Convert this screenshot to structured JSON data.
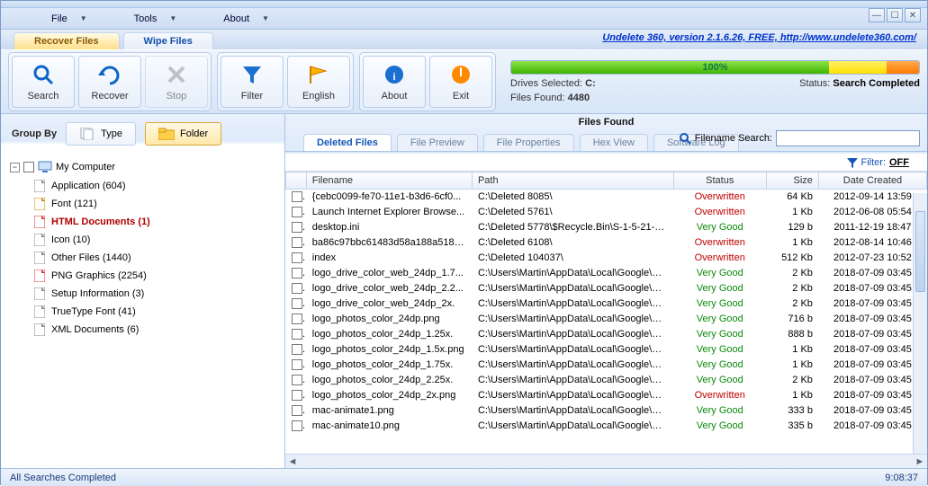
{
  "menu": {
    "file": "File",
    "tools": "Tools",
    "about": "About"
  },
  "tabs": {
    "recover": "Recover Files",
    "wipe": "Wipe Files"
  },
  "version_link": "Undelete 360, version 2.1.6.26, FREE, http://www.undelete360.com/",
  "toolbar": {
    "search": "Search",
    "recover": "Recover",
    "stop": "Stop",
    "filter": "Filter",
    "english": "English",
    "about": "About",
    "exit": "Exit"
  },
  "progress_pct": "100%",
  "drives_label": "Drives Selected: ",
  "drives_value": "C:",
  "found_label": "Files Found: ",
  "found_value": "4480",
  "status_label": "Status: ",
  "status_value": "Search Completed",
  "group_by": "Group By",
  "type_btn": "Type",
  "folder_btn": "Folder",
  "tree_root": "My Computer",
  "tree_items": [
    "Application (604)",
    "Font (121)",
    "HTML Documents (1)",
    "Icon (10)",
    "Other Files (1440)",
    "PNG Graphics (2254)",
    "Setup Information (3)",
    "TrueType Font (41)",
    "XML Documents (6)"
  ],
  "tree_selected_index": 2,
  "files_found_title": "Files Found",
  "right_tabs": {
    "deleted": "Deleted Files",
    "preview": "File Preview",
    "props": "File Properties",
    "hex": "Hex View",
    "log": "Software Log"
  },
  "search_label": "Filename Search:",
  "filter_label": "Filter:",
  "filter_state": "OFF",
  "columns": {
    "fn": "Filename",
    "path": "Path",
    "status": "Status",
    "size": "Size",
    "date": "Date Created"
  },
  "rows": [
    {
      "fn": "{cebc0099-fe70-11e1-b3d6-6cf0...",
      "path": "C:\\Deleted 8085\\",
      "status": "Overwritten",
      "size": "64 Kb",
      "date": "2012-09-14 13:59"
    },
    {
      "fn": "Launch Internet Explorer Browse...",
      "path": "C:\\Deleted 5761\\",
      "status": "Overwritten",
      "size": "1 Kb",
      "date": "2012-06-08 05:54"
    },
    {
      "fn": "desktop.ini",
      "path": "C:\\Deleted 5778\\$Recycle.Bin\\S-1-5-21-2...",
      "status": "Very Good",
      "size": "129 b",
      "date": "2011-12-19 18:47"
    },
    {
      "fn": "ba86c97bbc61483d58a188a5182...",
      "path": "C:\\Deleted 6108\\",
      "status": "Overwritten",
      "size": "1 Kb",
      "date": "2012-08-14 10:46"
    },
    {
      "fn": "index",
      "path": "C:\\Deleted 104037\\",
      "status": "Overwritten",
      "size": "512 Kb",
      "date": "2012-07-23 10:52"
    },
    {
      "fn": "logo_drive_color_web_24dp_1.7...",
      "path": "C:\\Users\\Martin\\AppData\\Local\\Google\\Ch...",
      "status": "Very Good",
      "size": "2 Kb",
      "date": "2018-07-09 03:45"
    },
    {
      "fn": "logo_drive_color_web_24dp_2.2...",
      "path": "C:\\Users\\Martin\\AppData\\Local\\Google\\Ch...",
      "status": "Very Good",
      "size": "2 Kb",
      "date": "2018-07-09 03:45"
    },
    {
      "fn": "logo_drive_color_web_24dp_2x.",
      "path": "C:\\Users\\Martin\\AppData\\Local\\Google\\Ch...",
      "status": "Very Good",
      "size": "2 Kb",
      "date": "2018-07-09 03:45"
    },
    {
      "fn": "logo_photos_color_24dp.png",
      "path": "C:\\Users\\Martin\\AppData\\Local\\Google\\Ch...",
      "status": "Very Good",
      "size": "716 b",
      "date": "2018-07-09 03:45"
    },
    {
      "fn": "logo_photos_color_24dp_1.25x.",
      "path": "C:\\Users\\Martin\\AppData\\Local\\Google\\Ch...",
      "status": "Very Good",
      "size": "888 b",
      "date": "2018-07-09 03:45"
    },
    {
      "fn": "logo_photos_color_24dp_1.5x.png",
      "path": "C:\\Users\\Martin\\AppData\\Local\\Google\\Ch...",
      "status": "Very Good",
      "size": "1 Kb",
      "date": "2018-07-09 03:45"
    },
    {
      "fn": "logo_photos_color_24dp_1.75x.",
      "path": "C:\\Users\\Martin\\AppData\\Local\\Google\\Ch...",
      "status": "Very Good",
      "size": "1 Kb",
      "date": "2018-07-09 03:45"
    },
    {
      "fn": "logo_photos_color_24dp_2.25x.",
      "path": "C:\\Users\\Martin\\AppData\\Local\\Google\\Ch...",
      "status": "Very Good",
      "size": "2 Kb",
      "date": "2018-07-09 03:45"
    },
    {
      "fn": "logo_photos_color_24dp_2x.png",
      "path": "C:\\Users\\Martin\\AppData\\Local\\Google\\Ch...",
      "status": "Overwritten",
      "size": "1 Kb",
      "date": "2018-07-09 03:45"
    },
    {
      "fn": "mac-animate1.png",
      "path": "C:\\Users\\Martin\\AppData\\Local\\Google\\Ch...",
      "status": "Very Good",
      "size": "333 b",
      "date": "2018-07-09 03:45"
    },
    {
      "fn": "mac-animate10.png",
      "path": "C:\\Users\\Martin\\AppData\\Local\\Google\\Ch...",
      "status": "Very Good",
      "size": "335 b",
      "date": "2018-07-09 03:45"
    }
  ],
  "statusbar_left": "All Searches Completed",
  "statusbar_right": "9:08:37"
}
